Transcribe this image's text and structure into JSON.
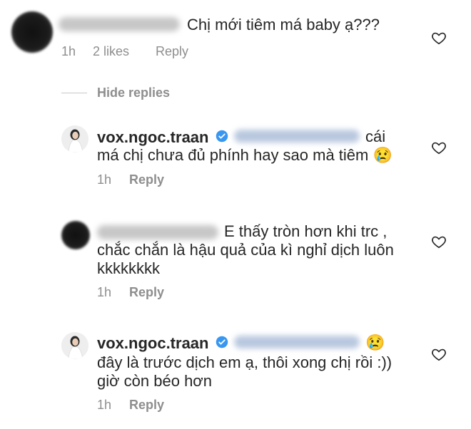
{
  "comments": [
    {
      "text": "Chị mới tiêm má baby ạ???",
      "time": "1h",
      "likes": "2 likes",
      "reply_label": "Reply"
    }
  ],
  "hide_replies_label": "Hide replies",
  "replies": [
    {
      "username": "vox.ngoc.traan",
      "text_line1": "cái",
      "text_line2": "má chị chưa đủ phính hay sao mà tiêm 😢",
      "time": "1h",
      "reply_label": "Reply"
    },
    {
      "text_line1": "E thấy tròn hơn khi trc ,",
      "text_line2": "chắc chắn là hậu quả của kì nghỉ dịch luôn",
      "text_line3": "kkkkkkkk",
      "time": "1h",
      "reply_label": "Reply"
    },
    {
      "username": "vox.ngoc.traan",
      "text_line1": "😢",
      "text_line2": "đây là trước dịch em ạ, thôi xong chị rồi :))",
      "text_line3": "giờ còn béo hơn",
      "time": "1h",
      "reply_label": "Reply"
    }
  ],
  "colors": {
    "text": "#262626",
    "meta": "#8e8e8e",
    "verified": "#3897f0"
  },
  "icons": [
    "heart-icon",
    "verified-icon"
  ]
}
